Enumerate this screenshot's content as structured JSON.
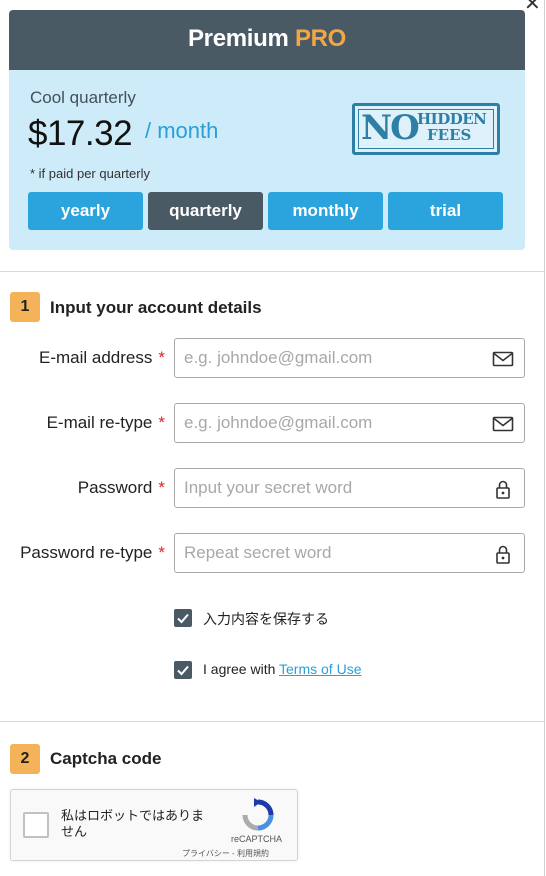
{
  "window": {
    "close_glyph": "✕"
  },
  "header": {
    "title": "Premium",
    "accent": "PRO"
  },
  "plan": {
    "name": "Cool quarterly",
    "price": "$17.32",
    "per": "/ month",
    "note": "* if paid per quarterly",
    "stamp": {
      "no": "NO",
      "hidden": "HIDDEN",
      "fees": "FEES"
    },
    "periods": [
      {
        "label": "yearly",
        "selected": false
      },
      {
        "label": "quarterly",
        "selected": true
      },
      {
        "label": "monthly",
        "selected": false
      },
      {
        "label": "trial",
        "selected": false
      }
    ]
  },
  "step1": {
    "number": "1",
    "title": "Input your account details",
    "required_mark": "*",
    "fields": {
      "email": {
        "label": "E-mail address",
        "placeholder": "e.g. johndoe@gmail.com",
        "icon": "mail-icon"
      },
      "email_retype": {
        "label": "E-mail re-type",
        "placeholder": "e.g. johndoe@gmail.com",
        "icon": "mail-icon"
      },
      "password": {
        "label": "Password",
        "placeholder": "Input your secret word",
        "icon": "lock-icon"
      },
      "password_retype": {
        "label": "Password re-type",
        "placeholder": "Repeat secret word",
        "icon": "lock-icon"
      }
    },
    "remember": {
      "label": "入力内容を保存する",
      "checked": true
    },
    "agree": {
      "prefix": "I agree with ",
      "link": "Terms of Use",
      "checked": true
    }
  },
  "step2": {
    "number": "2",
    "title": "Captcha code",
    "captcha": {
      "label": "私はロボットではありません",
      "brand": "reCAPTCHA",
      "links": "プライバシー - 利用規約"
    }
  },
  "colors": {
    "header_bg": "#4a5a65",
    "accent_orange": "#f3a744",
    "plan_bg": "#cdebf8",
    "button_blue": "#2ba4dd",
    "button_selected": "#4a5a65",
    "link_blue": "#2a9fd8",
    "badge_orange": "#f5b359",
    "required_red": "#dd2222"
  }
}
